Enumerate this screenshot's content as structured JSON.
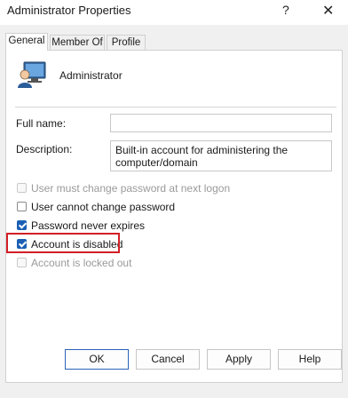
{
  "window": {
    "title": "Administrator Properties",
    "help_glyph": "?",
    "close_glyph": "✕"
  },
  "tabs": [
    {
      "label": "General",
      "active": true
    },
    {
      "label": "Member Of",
      "active": false
    },
    {
      "label": "Profile",
      "active": false
    }
  ],
  "user": {
    "icon": "user-computer-icon",
    "name": "Administrator"
  },
  "fields": {
    "full_name_label": "Full name:",
    "full_name_value": "",
    "description_label": "Description:",
    "description_value": "Built-in account for administering the computer/domain"
  },
  "checkboxes": [
    {
      "label": "User must change password at next logon",
      "checked": false,
      "enabled": false
    },
    {
      "label": "User cannot change password",
      "checked": false,
      "enabled": true
    },
    {
      "label": "Password never expires",
      "checked": true,
      "enabled": true
    },
    {
      "label": "Account is disabled",
      "checked": true,
      "enabled": true,
      "highlighted": true
    },
    {
      "label": "Account is locked out",
      "checked": false,
      "enabled": false
    }
  ],
  "buttons": {
    "ok": "OK",
    "cancel": "Cancel",
    "apply": "Apply",
    "help": "Help"
  },
  "colors": {
    "accent": "#1a5fb4",
    "highlight_border": "#d21f26"
  }
}
